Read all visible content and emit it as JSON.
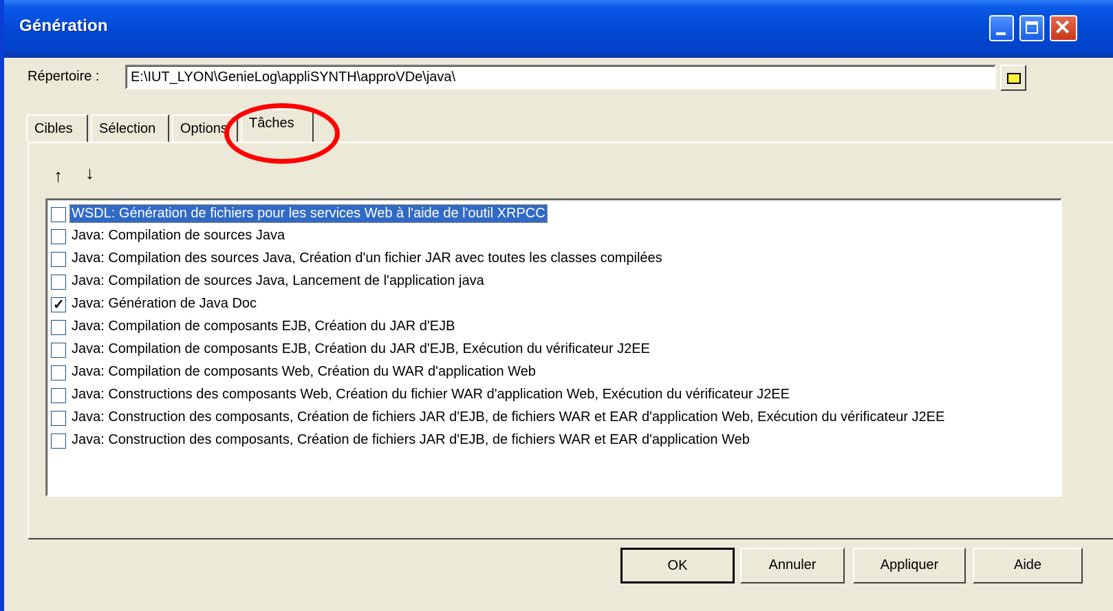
{
  "window": {
    "title": "Génération"
  },
  "directory": {
    "label": "Répertoire :",
    "value": "E:\\IUT_LYON\\GenieLog\\appliSYNTH\\approVDe\\java\\"
  },
  "tabs": [
    {
      "label": "Cibles"
    },
    {
      "label": "Sélection"
    },
    {
      "label": "Options"
    },
    {
      "label": "Tâches",
      "active": true
    }
  ],
  "toolbar": {
    "up": "↑",
    "down": "↓"
  },
  "tasks": [
    {
      "label": "WSDL: Génération de fichiers pour les services Web à l'aide de l'outil XRPCC",
      "checked": false,
      "selected": true
    },
    {
      "label": "Java: Compilation de sources Java",
      "checked": false
    },
    {
      "label": "Java: Compilation des sources Java, Création d'un fichier JAR avec toutes les classes compilées",
      "checked": false
    },
    {
      "label": "Java: Compilation de sources Java, Lancement de l'application java",
      "checked": false
    },
    {
      "label": "Java: Génération de Java Doc",
      "checked": true
    },
    {
      "label": "Java: Compilation de composants EJB, Création du JAR d'EJB",
      "checked": false
    },
    {
      "label": "Java: Compilation de composants EJB, Création du JAR d'EJB, Exécution du vérificateur J2EE",
      "checked": false
    },
    {
      "label": "Java: Compilation de composants Web, Création du WAR d'application Web",
      "checked": false
    },
    {
      "label": "Java: Constructions des composants Web, Création du fichier WAR d'application Web, Exécution du vérificateur J2EE",
      "checked": false
    },
    {
      "label": "Java: Construction des composants, Création de fichiers JAR d'EJB, de fichiers WAR et EAR d'application Web, Exécution du vérificateur J2EE",
      "checked": false
    },
    {
      "label": "Java: Construction des composants, Création de fichiers JAR d'EJB, de fichiers WAR et EAR d'application Web",
      "checked": false
    }
  ],
  "buttons": {
    "ok": "OK",
    "cancel": "Annuler",
    "apply": "Appliquer",
    "help": "Aide"
  },
  "colors": {
    "titlebar": "#0349d6",
    "selection": "#316ac5",
    "highlight_circle": "#ff0000",
    "face": "#ece9d8"
  }
}
